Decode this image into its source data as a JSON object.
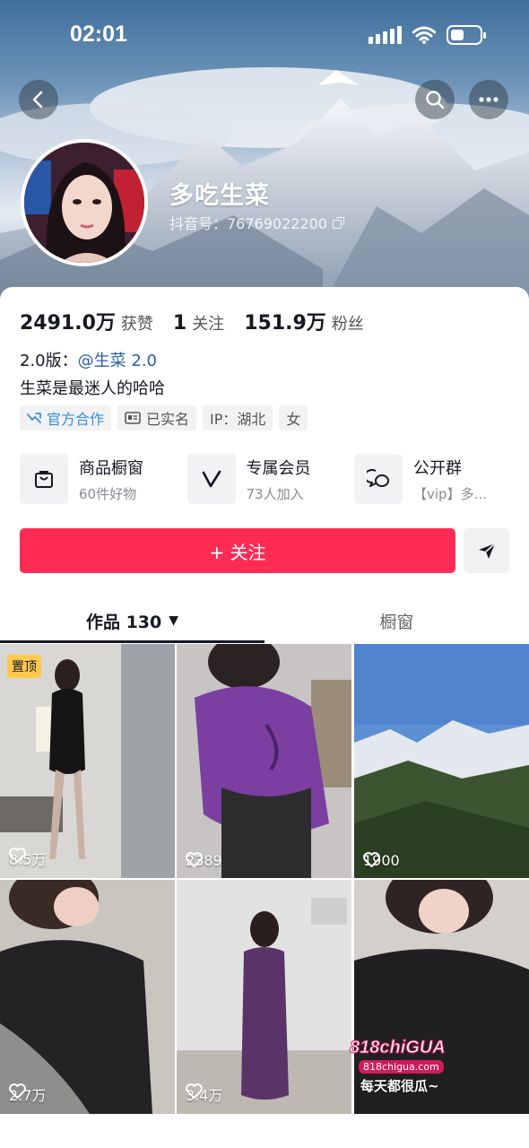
{
  "status_bar": {
    "time": "02:01"
  },
  "profile": {
    "nickname": "多吃生菜",
    "douyin_id": "抖音号：76769022200",
    "stats": [
      {
        "num": "2491.0万",
        "label": "获赞"
      },
      {
        "num": "1",
        "label": "关注"
      },
      {
        "num": "151.9万",
        "label": "粉丝"
      }
    ],
    "version_prefix": "2.0版：",
    "version_mention": "@生菜 2.0",
    "bio": "生菜是最迷人的哈哈",
    "tags": [
      "官方合作",
      "已实名",
      "IP：湖北",
      "女"
    ]
  },
  "features": [
    {
      "title": "商品橱窗",
      "subtitle": "60件好物",
      "icon": "bag-icon"
    },
    {
      "title": "专属会员",
      "subtitle": "73人加入",
      "icon": "v-icon"
    },
    {
      "title": "公开群",
      "subtitle": "【vip】多...",
      "icon": "chat-icon"
    }
  ],
  "actions": {
    "follow_label": "+ 关注"
  },
  "tabs": {
    "works": "作品 130",
    "store": "橱窗"
  },
  "videos": [
    {
      "likes": "8.5万",
      "pinned": "置顶"
    },
    {
      "likes": "2389"
    },
    {
      "likes": "1900"
    },
    {
      "likes": "2.7万"
    },
    {
      "likes": "3.4万"
    },
    {
      "likes": ""
    }
  ],
  "watermark": {
    "logo_number": "818",
    "logo_text": "chiGUA",
    "url": "818chigua.com",
    "slogan": "每天都很瓜~"
  },
  "colors": {
    "follow": "#fe2c55",
    "mention": "#2b5fa6",
    "official_tag": "#3a8fd6",
    "pin_badge": "#fec94d"
  }
}
